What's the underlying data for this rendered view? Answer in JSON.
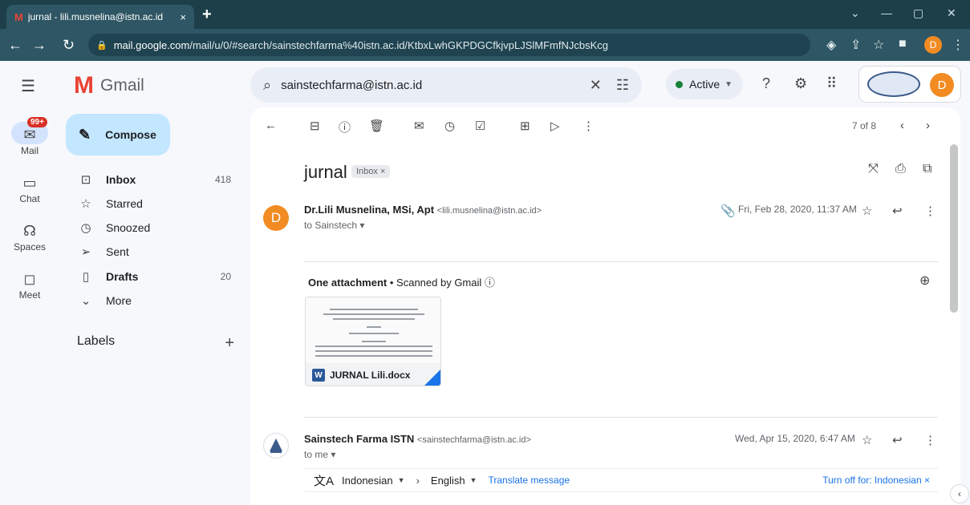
{
  "browser": {
    "tab_title": "jurnal - lili.musnelina@istn.ac.id",
    "tab_close": "×",
    "new_tab": "+",
    "url_host": "mail.google.com",
    "url_path": "/mail/u/0/#search/sainstechfarma%40istn.ac.id/KtbxLwhGKPDGCfkjvpLJSlMFmfNJcbsKcg",
    "profile_initial": "D"
  },
  "header": {
    "app_name": "Gmail",
    "search_query": "sainstechfarma@istn.ac.id",
    "status": "Active",
    "account_initial": "D"
  },
  "rail": {
    "mail_badge": "99+",
    "items": [
      {
        "label": "Mail"
      },
      {
        "label": "Chat"
      },
      {
        "label": "Spaces"
      },
      {
        "label": "Meet"
      }
    ]
  },
  "sidebar": {
    "compose": "Compose",
    "items": [
      {
        "label": "Inbox",
        "count": "418"
      },
      {
        "label": "Starred",
        "count": ""
      },
      {
        "label": "Snoozed",
        "count": ""
      },
      {
        "label": "Sent",
        "count": ""
      },
      {
        "label": "Drafts",
        "count": "20"
      },
      {
        "label": "More",
        "count": ""
      }
    ],
    "labels_title": "Labels"
  },
  "thread": {
    "pager": "7 of 8",
    "subject": "jurnal",
    "label_chip": "Inbox ×",
    "messages": [
      {
        "avatar": "D",
        "sender_name": "Dr.Lili Musnelina, MSi, Apt",
        "sender_email": "<lili.musnelina@istn.ac.id>",
        "to": "to Sainstech ▾",
        "date": "Fri, Feb 28, 2020, 11:37 AM"
      },
      {
        "sender_name": "Sainstech Farma ISTN",
        "sender_email": "<sainstechfarma@istn.ac.id>",
        "to": "to me ▾",
        "date": "Wed, Apr 15, 2020, 6:47 AM"
      }
    ],
    "attachment_count": "One attachment",
    "scanned": "• Scanned by Gmail ⓘ",
    "attachment_name": "JURNAL Lili.docx",
    "attachment_type_letter": "W"
  },
  "translate": {
    "from": "Indonesian",
    "to": "English",
    "action": "Translate message",
    "turn_off": "Turn off for: Indonesian ×"
  }
}
